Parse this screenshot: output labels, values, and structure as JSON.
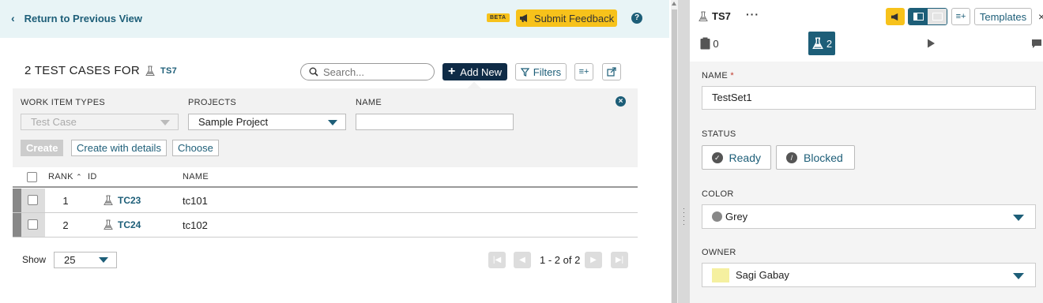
{
  "topbar": {
    "back_label": "Return to Previous View",
    "beta_badge": "BETA",
    "feedback_label": "Submit Feedback",
    "help_icon": "?"
  },
  "header": {
    "title_prefix": "2 TEST CASES FOR",
    "title_ref": "TS7",
    "search_placeholder": "Search...",
    "add_new_label": "Add New",
    "filters_label": "Filters",
    "columns_icon": "≡+"
  },
  "add_panel": {
    "labels": {
      "work_item_types": "WORK ITEM TYPES",
      "projects": "PROJECTS",
      "name": "NAME"
    },
    "work_item_type_value": "Test Case",
    "project_value": "Sample Project",
    "name_value": "",
    "create_label": "Create",
    "create_with_details_label": "Create with details",
    "choose_label": "Choose"
  },
  "table": {
    "columns": {
      "rank": "RANK",
      "id": "ID",
      "name": "NAME"
    },
    "rows": [
      {
        "rank": "1",
        "id": "TC23",
        "name": "tc101"
      },
      {
        "rank": "2",
        "id": "TC24",
        "name": "tc102"
      }
    ]
  },
  "footer": {
    "show_label": "Show",
    "page_size": "25",
    "pagination": "1 - 2 of 2"
  },
  "detail": {
    "title": "TS7",
    "more_icon": "···",
    "columns_icon": "≡+",
    "templates_label": "Templates",
    "tabs": {
      "comments_count": "0",
      "tests_count": "2"
    },
    "fields": {
      "name_label": "NAME",
      "required_mark": "*",
      "name_value": "TestSet1",
      "status_label": "STATUS",
      "status_ready": "Ready",
      "status_blocked": "Blocked",
      "color_label": "COLOR",
      "color_value": "Grey",
      "owner_label": "OWNER",
      "owner_value": "Sagi Gabay"
    }
  },
  "colors": {
    "accent": "#1d5e78",
    "feedback": "#f7c21b",
    "primary_button": "#0f2b46",
    "topbar_bg": "#e8f4f6"
  },
  "icons": [
    "chevron-left-icon",
    "megaphone-icon",
    "help-icon",
    "flask-icon",
    "search-icon",
    "plus-icon",
    "filter-icon",
    "columns-icon",
    "share-icon",
    "close-icon",
    "sort-asc-icon",
    "clipboard-icon",
    "play-icon",
    "check-circle-icon",
    "blocked-icon",
    "first-page-icon",
    "prev-page-icon",
    "next-page-icon",
    "last-page-icon"
  ]
}
